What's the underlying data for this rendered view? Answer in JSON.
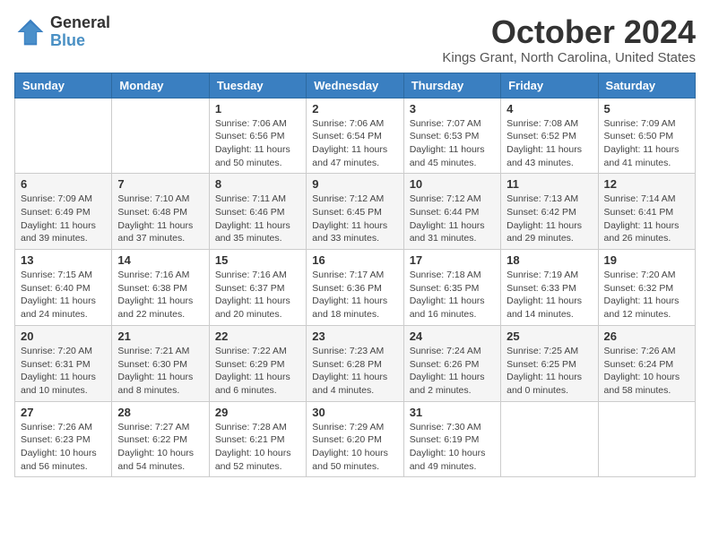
{
  "logo": {
    "general": "General",
    "blue": "Blue"
  },
  "header": {
    "month": "October 2024",
    "location": "Kings Grant, North Carolina, United States"
  },
  "days_of_week": [
    "Sunday",
    "Monday",
    "Tuesday",
    "Wednesday",
    "Thursday",
    "Friday",
    "Saturday"
  ],
  "weeks": [
    [
      {
        "day": "",
        "info": ""
      },
      {
        "day": "",
        "info": ""
      },
      {
        "day": "1",
        "info": "Sunrise: 7:06 AM\nSunset: 6:56 PM\nDaylight: 11 hours and 50 minutes."
      },
      {
        "day": "2",
        "info": "Sunrise: 7:06 AM\nSunset: 6:54 PM\nDaylight: 11 hours and 47 minutes."
      },
      {
        "day": "3",
        "info": "Sunrise: 7:07 AM\nSunset: 6:53 PM\nDaylight: 11 hours and 45 minutes."
      },
      {
        "day": "4",
        "info": "Sunrise: 7:08 AM\nSunset: 6:52 PM\nDaylight: 11 hours and 43 minutes."
      },
      {
        "day": "5",
        "info": "Sunrise: 7:09 AM\nSunset: 6:50 PM\nDaylight: 11 hours and 41 minutes."
      }
    ],
    [
      {
        "day": "6",
        "info": "Sunrise: 7:09 AM\nSunset: 6:49 PM\nDaylight: 11 hours and 39 minutes."
      },
      {
        "day": "7",
        "info": "Sunrise: 7:10 AM\nSunset: 6:48 PM\nDaylight: 11 hours and 37 minutes."
      },
      {
        "day": "8",
        "info": "Sunrise: 7:11 AM\nSunset: 6:46 PM\nDaylight: 11 hours and 35 minutes."
      },
      {
        "day": "9",
        "info": "Sunrise: 7:12 AM\nSunset: 6:45 PM\nDaylight: 11 hours and 33 minutes."
      },
      {
        "day": "10",
        "info": "Sunrise: 7:12 AM\nSunset: 6:44 PM\nDaylight: 11 hours and 31 minutes."
      },
      {
        "day": "11",
        "info": "Sunrise: 7:13 AM\nSunset: 6:42 PM\nDaylight: 11 hours and 29 minutes."
      },
      {
        "day": "12",
        "info": "Sunrise: 7:14 AM\nSunset: 6:41 PM\nDaylight: 11 hours and 26 minutes."
      }
    ],
    [
      {
        "day": "13",
        "info": "Sunrise: 7:15 AM\nSunset: 6:40 PM\nDaylight: 11 hours and 24 minutes."
      },
      {
        "day": "14",
        "info": "Sunrise: 7:16 AM\nSunset: 6:38 PM\nDaylight: 11 hours and 22 minutes."
      },
      {
        "day": "15",
        "info": "Sunrise: 7:16 AM\nSunset: 6:37 PM\nDaylight: 11 hours and 20 minutes."
      },
      {
        "day": "16",
        "info": "Sunrise: 7:17 AM\nSunset: 6:36 PM\nDaylight: 11 hours and 18 minutes."
      },
      {
        "day": "17",
        "info": "Sunrise: 7:18 AM\nSunset: 6:35 PM\nDaylight: 11 hours and 16 minutes."
      },
      {
        "day": "18",
        "info": "Sunrise: 7:19 AM\nSunset: 6:33 PM\nDaylight: 11 hours and 14 minutes."
      },
      {
        "day": "19",
        "info": "Sunrise: 7:20 AM\nSunset: 6:32 PM\nDaylight: 11 hours and 12 minutes."
      }
    ],
    [
      {
        "day": "20",
        "info": "Sunrise: 7:20 AM\nSunset: 6:31 PM\nDaylight: 11 hours and 10 minutes."
      },
      {
        "day": "21",
        "info": "Sunrise: 7:21 AM\nSunset: 6:30 PM\nDaylight: 11 hours and 8 minutes."
      },
      {
        "day": "22",
        "info": "Sunrise: 7:22 AM\nSunset: 6:29 PM\nDaylight: 11 hours and 6 minutes."
      },
      {
        "day": "23",
        "info": "Sunrise: 7:23 AM\nSunset: 6:28 PM\nDaylight: 11 hours and 4 minutes."
      },
      {
        "day": "24",
        "info": "Sunrise: 7:24 AM\nSunset: 6:26 PM\nDaylight: 11 hours and 2 minutes."
      },
      {
        "day": "25",
        "info": "Sunrise: 7:25 AM\nSunset: 6:25 PM\nDaylight: 11 hours and 0 minutes."
      },
      {
        "day": "26",
        "info": "Sunrise: 7:26 AM\nSunset: 6:24 PM\nDaylight: 10 hours and 58 minutes."
      }
    ],
    [
      {
        "day": "27",
        "info": "Sunrise: 7:26 AM\nSunset: 6:23 PM\nDaylight: 10 hours and 56 minutes."
      },
      {
        "day": "28",
        "info": "Sunrise: 7:27 AM\nSunset: 6:22 PM\nDaylight: 10 hours and 54 minutes."
      },
      {
        "day": "29",
        "info": "Sunrise: 7:28 AM\nSunset: 6:21 PM\nDaylight: 10 hours and 52 minutes."
      },
      {
        "day": "30",
        "info": "Sunrise: 7:29 AM\nSunset: 6:20 PM\nDaylight: 10 hours and 50 minutes."
      },
      {
        "day": "31",
        "info": "Sunrise: 7:30 AM\nSunset: 6:19 PM\nDaylight: 10 hours and 49 minutes."
      },
      {
        "day": "",
        "info": ""
      },
      {
        "day": "",
        "info": ""
      }
    ]
  ]
}
